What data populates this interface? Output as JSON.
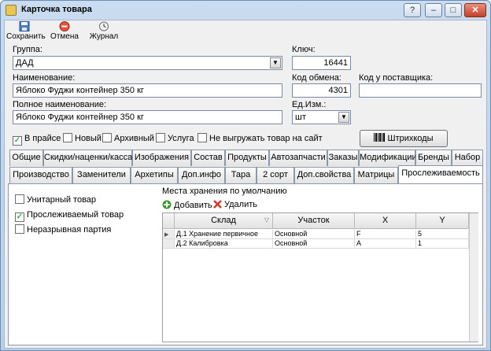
{
  "window": {
    "title": "Карточка товара",
    "help_label": "?",
    "minimize_label": "–",
    "maximize_label": "□",
    "close_label": "✕"
  },
  "toolbar": {
    "save_label": "Сохранить",
    "cancel_label": "Отмена",
    "journal_label": "Журнал"
  },
  "form": {
    "group_label": "Группа:",
    "group_value": "ДАД",
    "key_label": "Ключ:",
    "key_value": "16441",
    "name_label": "Наименование:",
    "name_value": "Яблоко Фуджи контейнер 350 кг",
    "exchange_code_label": "Код обмена:",
    "exchange_code_value": "4301",
    "supplier_code_label": "Код у поставщика:",
    "supplier_code_value": "",
    "full_name_label": "Полное наименование:",
    "full_name_value": "Яблоко Фуджи контейнер 350 кг",
    "unit_label": "Ед.Изм.:",
    "unit_value": "шт"
  },
  "flags": [
    {
      "label": "В прайсе",
      "checked": true
    },
    {
      "label": "Новый",
      "checked": false
    },
    {
      "label": "Архивный",
      "checked": false
    },
    {
      "label": "Услуга",
      "checked": false
    },
    {
      "label": "Не выгружать товар на сайт",
      "checked": false
    }
  ],
  "barcodes_button": "Штрихкоды",
  "tabs_row1": [
    "Общие",
    "Скидки/наценки/касса",
    "Изображения",
    "Состав",
    "Продукты",
    "Автозапчасти",
    "Заказы",
    "Модификации",
    "Бренды",
    "Набор"
  ],
  "tabs_row2": [
    "Производство",
    "Заменители",
    "Архетипы",
    "Доп.инфо",
    "Тара",
    "2 сорт",
    "Доп.свойства",
    "Матрицы",
    "Прослеживаемость"
  ],
  "tracking": {
    "options": [
      {
        "label": "Унитарный товар",
        "checked": false
      },
      {
        "label": "Прослеживаемый товар",
        "checked": true
      },
      {
        "label": "Неразрывная партия",
        "checked": false
      }
    ],
    "storage_title": "Места хранения по умолчанию",
    "add_label": "Добавить",
    "delete_label": "Удалить",
    "columns": [
      "Склад",
      "Участок",
      "X",
      "Y"
    ],
    "rows": [
      [
        "Д.1 Хранение первичное",
        "Основной",
        "F",
        "5"
      ],
      [
        "Д.2 Калибровка",
        "Основной",
        "A",
        "1"
      ]
    ]
  },
  "colors": {
    "title_bar": "#b7cfe9",
    "client_bg": "#f0f0f0",
    "add_green": "#3a9a2e",
    "delete_red": "#d23a2a"
  }
}
